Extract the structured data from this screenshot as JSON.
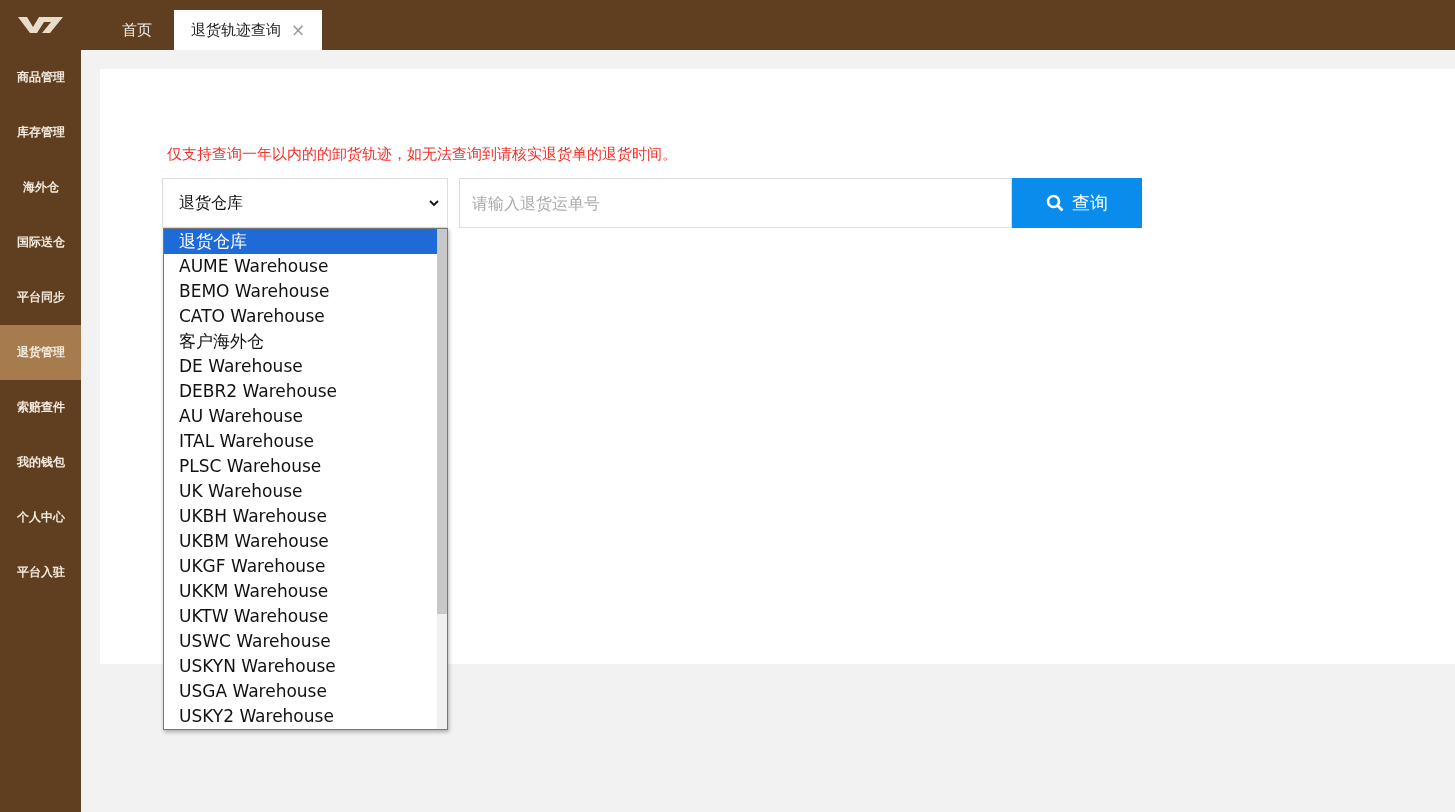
{
  "top_bar": {
    "tabs": [
      {
        "label": "首页",
        "selected": false
      },
      {
        "label": "退货轨迹查询",
        "selected": true,
        "close": "×"
      }
    ]
  },
  "sidebar": {
    "items": [
      {
        "label": "商品管理",
        "selected": false
      },
      {
        "label": "库存管理",
        "selected": false
      },
      {
        "label": "海外仓",
        "selected": false
      },
      {
        "label": "国际送仓",
        "selected": false
      },
      {
        "label": "平台同步",
        "selected": false
      },
      {
        "label": "退货管理",
        "selected": true
      },
      {
        "label": "索赔查件",
        "selected": false
      },
      {
        "label": "我的钱包",
        "selected": false
      },
      {
        "label": "个人中心",
        "selected": false
      },
      {
        "label": "平台入驻",
        "selected": false
      }
    ]
  },
  "notice": "仅支持查询一年以内的的卸货轨迹，如无法查询到请核实退货单的退货时间。",
  "warehouse_select": {
    "value": "退货仓库",
    "expanded": true,
    "options": [
      {
        "label": "退货仓库",
        "selected": true
      },
      {
        "label": "AUME Warehouse",
        "selected": false
      },
      {
        "label": "BEMO Warehouse",
        "selected": false
      },
      {
        "label": "CATO Warehouse",
        "selected": false
      },
      {
        "label": "客户海外仓",
        "selected": false
      },
      {
        "label": "DE Warehouse",
        "selected": false
      },
      {
        "label": "DEBR2 Warehouse",
        "selected": false
      },
      {
        "label": "AU Warehouse",
        "selected": false
      },
      {
        "label": "ITAL Warehouse",
        "selected": false
      },
      {
        "label": "PLSC Warehouse",
        "selected": false
      },
      {
        "label": "UK Warehouse",
        "selected": false
      },
      {
        "label": "UKBH Warehouse",
        "selected": false
      },
      {
        "label": "UKBM Warehouse",
        "selected": false
      },
      {
        "label": "UKGF Warehouse",
        "selected": false
      },
      {
        "label": "UKKM Warehouse",
        "selected": false
      },
      {
        "label": "UKTW Warehouse",
        "selected": false
      },
      {
        "label": "USWC Warehouse",
        "selected": false
      },
      {
        "label": "USKYN Warehouse",
        "selected": false
      },
      {
        "label": "USGA Warehouse",
        "selected": false
      },
      {
        "label": "USKY2 Warehouse",
        "selected": false
      }
    ]
  },
  "tracking_field": {
    "placeholder": "请输入退货运单号"
  },
  "search_button": {
    "label": "查询"
  }
}
